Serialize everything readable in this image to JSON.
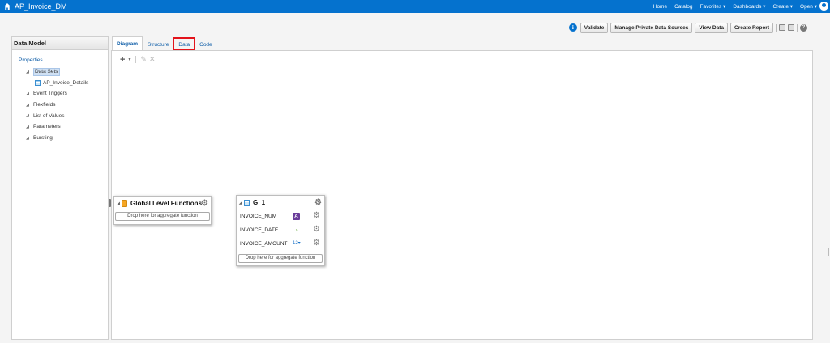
{
  "app": {
    "title": "AP_Invoice_DM"
  },
  "topnav": {
    "items": [
      {
        "label": "Home"
      },
      {
        "label": "Catalog"
      },
      {
        "label": "Favorites ▾"
      },
      {
        "label": "Dashboards ▾"
      },
      {
        "label": "Create ▾"
      },
      {
        "label": "Open ▾"
      }
    ]
  },
  "toolbar": {
    "validate": "Validate",
    "manage_sources": "Manage Private Data Sources",
    "view_data": "View Data",
    "create_report": "Create Report",
    "help": "?"
  },
  "left_panel": {
    "title": "Data Model",
    "root": "Properties",
    "items": [
      {
        "label": "Data Sets",
        "selected": true
      },
      {
        "label": "AP_Invoice_Details",
        "child": true
      },
      {
        "label": "Event Triggers"
      },
      {
        "label": "Flexfields"
      },
      {
        "label": "List of Values"
      },
      {
        "label": "Parameters"
      },
      {
        "label": "Bursting"
      }
    ]
  },
  "tabs": [
    {
      "label": "Diagram",
      "active": true
    },
    {
      "label": "Structure"
    },
    {
      "label": "Data",
      "highlighted": true
    },
    {
      "label": "Code"
    }
  ],
  "canvas_tools": {
    "add": "+",
    "edit": "✎",
    "delete": "✕"
  },
  "global_functions": {
    "title": "Global Level Functions",
    "drop_hint": "Drop here for aggregate function"
  },
  "group": {
    "title": "G_1",
    "columns": [
      {
        "name": "INVOICE_NUM",
        "type_icon": "string-type-icon",
        "type_glyph": "A"
      },
      {
        "name": "INVOICE_DATE",
        "type_icon": "date-type-icon",
        "type_glyph": "◔"
      },
      {
        "name": "INVOICE_AMOUNT",
        "type_icon": "number-type-icon",
        "type_glyph": "12▾"
      }
    ],
    "drop_hint": "Drop here for aggregate function"
  },
  "colors": {
    "brand_bar": "#0572ce",
    "highlight": "#e3131b",
    "link": "#0f5ea8"
  }
}
